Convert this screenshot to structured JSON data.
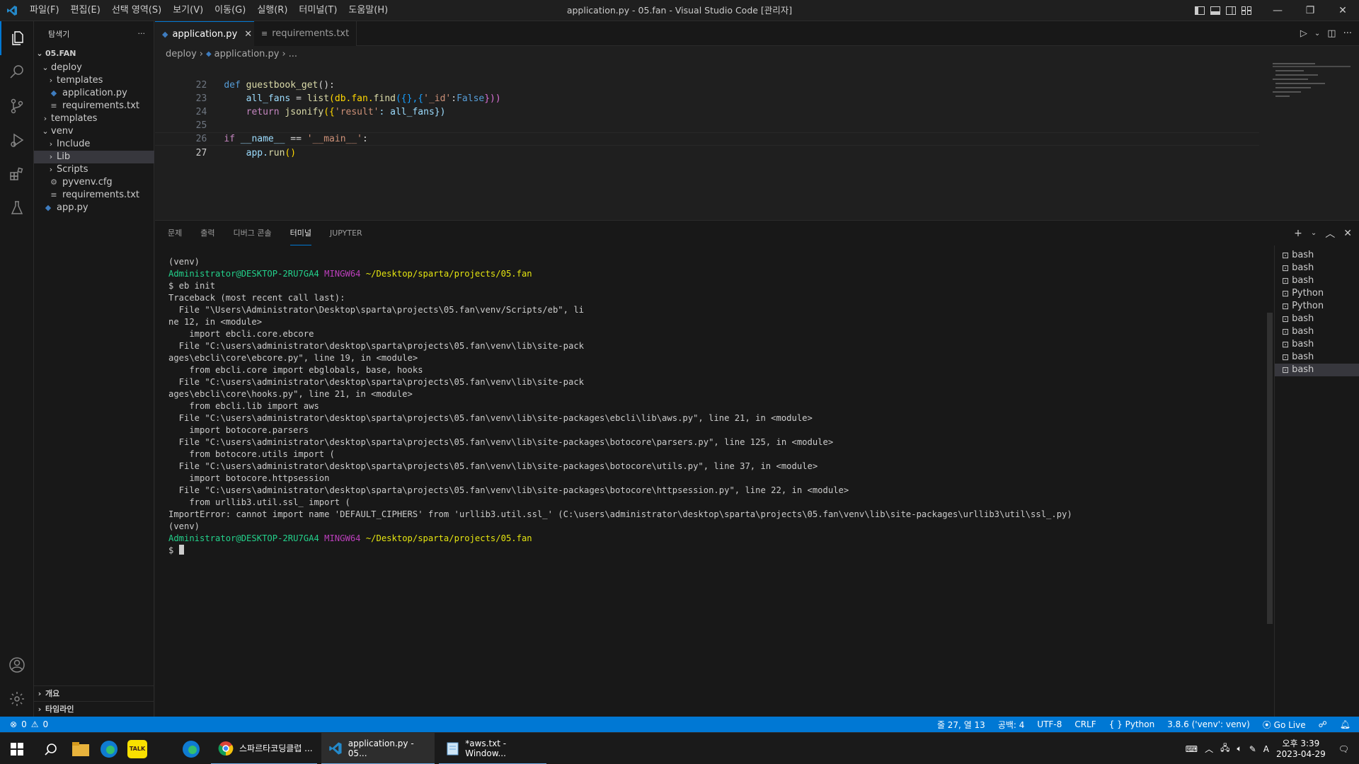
{
  "menu": [
    "파일(F)",
    "편집(E)",
    "선택 영역(S)",
    "보기(V)",
    "이동(G)",
    "실행(R)",
    "터미널(T)",
    "도움말(H)"
  ],
  "window_title": "application.py - 05.fan - Visual Studio Code [관리자]",
  "sidebar": {
    "title": "탐색기",
    "more": "···",
    "root": "05.FAN",
    "items": [
      {
        "label": "deploy",
        "indent": 1,
        "type": "folder-open"
      },
      {
        "label": "templates",
        "indent": 2,
        "type": "folder"
      },
      {
        "label": "application.py",
        "indent": 2,
        "type": "py"
      },
      {
        "label": "requirements.txt",
        "indent": 2,
        "type": "txt"
      },
      {
        "label": "templates",
        "indent": 1,
        "type": "folder"
      },
      {
        "label": "venv",
        "indent": 1,
        "type": "folder-open"
      },
      {
        "label": "Include",
        "indent": 2,
        "type": "folder"
      },
      {
        "label": "Lib",
        "indent": 2,
        "type": "folder",
        "selected": true
      },
      {
        "label": "Scripts",
        "indent": 2,
        "type": "folder"
      },
      {
        "label": "pyvenv.cfg",
        "indent": 2,
        "type": "cfg"
      },
      {
        "label": "requirements.txt",
        "indent": 2,
        "type": "txt"
      },
      {
        "label": "app.py",
        "indent": 1,
        "type": "py"
      }
    ],
    "outline": "개요",
    "timeline": "타임라인"
  },
  "tabs": [
    {
      "label": "application.py",
      "active": true
    },
    {
      "label": "requirements.txt",
      "active": false
    }
  ],
  "breadcrumb": {
    "folder": "deploy",
    "file": "application.py",
    "rest": "..."
  },
  "editor": {
    "lines": [
      {
        "n": "22"
      },
      {
        "n": "23"
      },
      {
        "n": "24"
      },
      {
        "n": "25"
      },
      {
        "n": "26"
      },
      {
        "n": "27"
      }
    ],
    "code": {
      "l22_def": "def",
      "l22_fn": "guestbook_get",
      "l22_rest": "():",
      "l23_a": "all_fans",
      "l23_b": " = ",
      "l23_c": "list",
      "l23_d": "(db.fan.",
      "l23_e": "find",
      "l23_f": "({},{",
      "l23_g": "'_id'",
      "l23_h": ":",
      "l23_i": "False",
      "l23_j": "}))",
      "l24_a": "return",
      "l24_b": "jsonify",
      "l24_c": "({",
      "l24_d": "'result'",
      "l24_e": ": all_fans})",
      "l26_a": "if",
      "l26_b": "__name__",
      "l26_c": " == ",
      "l26_d": "'__main__'",
      "l26_e": ":",
      "l27_a": "app.",
      "l27_b": "run",
      "l27_c": "()"
    }
  },
  "panel": {
    "tabs": [
      "문제",
      "출력",
      "디버그 콘솔",
      "터미널",
      "JUPYTER"
    ],
    "active_tab": "터미널",
    "terminal": {
      "user": "Administrator@DESKTOP-2RU7GA4",
      "ming": "MINGW64",
      "path": "~/Desktop/sparta/projects/05.fan",
      "lines": [
        "(venv)",
        "PROMPT",
        "$ eb init",
        "Traceback (most recent call last):",
        "  File \"\\Users\\Administrator\\Desktop\\sparta\\projects\\05.fan\\venv/Scripts/eb\", li",
        "ne 12, in <module>",
        "    import ebcli.core.ebcore",
        "  File \"C:\\users\\administrator\\desktop\\sparta\\projects\\05.fan\\venv\\lib\\site-pack",
        "ages\\ebcli\\core\\ebcore.py\", line 19, in <module>",
        "    from ebcli.core import ebglobals, base, hooks",
        "  File \"C:\\users\\administrator\\desktop\\sparta\\projects\\05.fan\\venv\\lib\\site-pack",
        "ages\\ebcli\\core\\hooks.py\", line 21, in <module>",
        "    from ebcli.lib import aws",
        "  File \"C:\\users\\administrator\\desktop\\sparta\\projects\\05.fan\\venv\\lib\\site-packages\\ebcli\\lib\\aws.py\", line 21, in <module>",
        "    import botocore.parsers",
        "  File \"C:\\users\\administrator\\desktop\\sparta\\projects\\05.fan\\venv\\lib\\site-packages\\botocore\\parsers.py\", line 125, in <module>",
        "    from botocore.utils import (",
        "  File \"C:\\users\\administrator\\desktop\\sparta\\projects\\05.fan\\venv\\lib\\site-packages\\botocore\\utils.py\", line 37, in <module>",
        "    import botocore.httpsession",
        "  File \"C:\\users\\administrator\\desktop\\sparta\\projects\\05.fan\\venv\\lib\\site-packages\\botocore\\httpsession.py\", line 22, in <module>",
        "    from urllib3.util.ssl_ import (",
        "ImportError: cannot import name 'DEFAULT_CIPHERS' from 'urllib3.util.ssl_' (C:\\users\\administrator\\desktop\\sparta\\projects\\05.fan\\venv\\lib\\site-packages\\urllib3\\util\\ssl_.py)",
        "(venv)",
        "PROMPT"
      ],
      "final_prompt": "$ "
    },
    "terminal_list": [
      "bash",
      "bash",
      "bash",
      "Python",
      "Python",
      "bash",
      "bash",
      "bash",
      "bash",
      "bash"
    ]
  },
  "statusbar": {
    "errors": "0",
    "warnings": "0",
    "position": "줄 27, 열 13",
    "spaces": "공백: 4",
    "encoding": "UTF-8",
    "eol": "CRLF",
    "language": "Python",
    "interpreter": "3.8.6 ('venv': venv)",
    "golive": "Go Live"
  },
  "taskbar": {
    "apps": [
      {
        "label": "스파르타코딩클럽 ..."
      },
      {
        "label": "application.py - 05..."
      },
      {
        "label": "*aws.txt - Window..."
      }
    ],
    "kakao": "TALK",
    "ime": "A",
    "time": "오후 3:39",
    "date": "2023-04-29"
  },
  "colors": {
    "accent": "#0078d4",
    "bg": "#1e1e1e",
    "sidebar": "#181818"
  }
}
